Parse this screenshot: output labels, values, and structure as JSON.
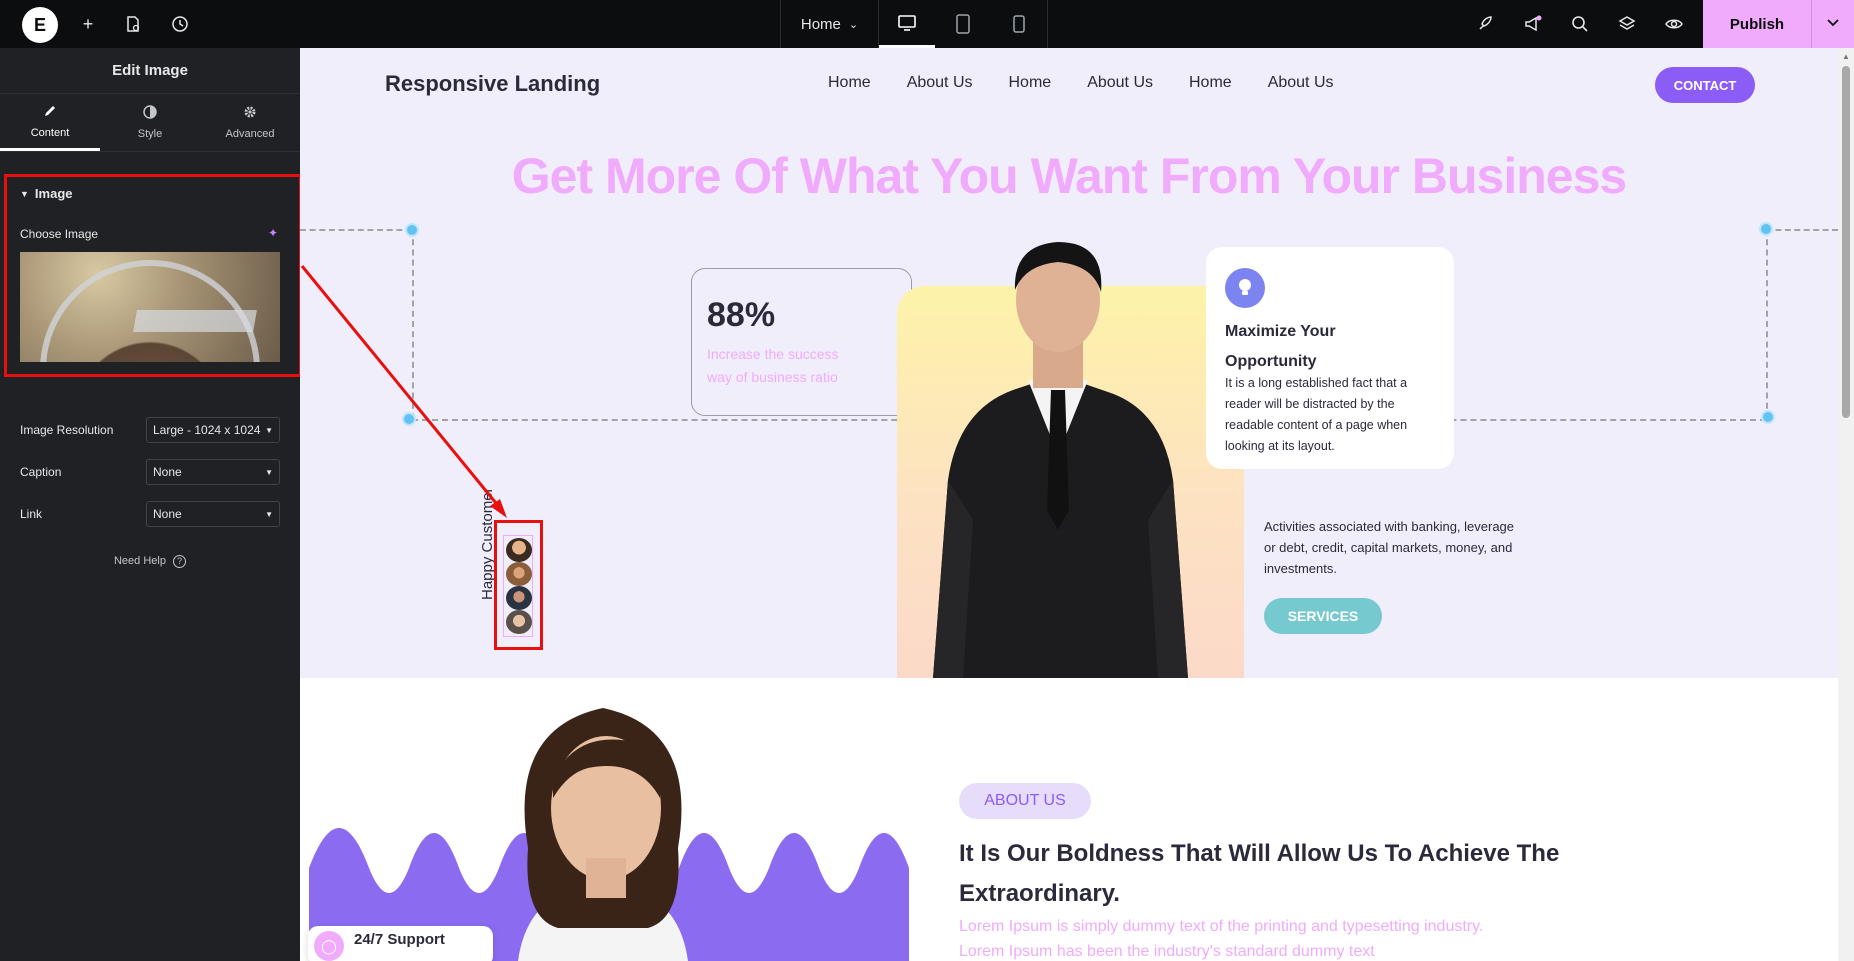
{
  "topbar": {
    "page_name": "Home",
    "publish_label": "Publish",
    "icons": [
      "elementor-logo-icon",
      "add-icon",
      "page-settings-icon",
      "history-icon",
      "desktop-icon",
      "tablet-icon",
      "mobile-icon",
      "rocket-icon",
      "announcements-icon",
      "search-icon",
      "layers-icon",
      "preview-icon",
      "chevron-down-icon"
    ]
  },
  "panel": {
    "title": "Edit Image",
    "tabs": [
      {
        "label": "Content",
        "icon": "pencil-icon"
      },
      {
        "label": "Style",
        "icon": "half-circle-icon"
      },
      {
        "label": "Advanced",
        "icon": "gear-icon"
      }
    ],
    "section_title": "Image",
    "choose_image_label": "Choose Image",
    "fields": [
      {
        "label": "Image Resolution",
        "value": "Large - 1024 x 1024"
      },
      {
        "label": "Caption",
        "value": "None"
      },
      {
        "label": "Link",
        "value": "None"
      }
    ],
    "need_help": "Need Help"
  },
  "site": {
    "brand": "Responsive Landing",
    "nav": [
      "Home",
      "About Us",
      "Home",
      "About Us",
      "Home",
      "About Us"
    ],
    "contact": "CONTACT",
    "headline": "Get More Of What You Want From Your Business",
    "stat": {
      "value": "88%",
      "text": "Increase the success way of business ratio"
    },
    "info_card": {
      "title": "Maximize Your Opportunity",
      "body": "It is a long established fact that a reader will be distracted by the readable content of a page when looking at its layout."
    },
    "activities": "Activities associated with banking, leverage or debt, credit, capital markets, money, and investments.",
    "services": "SERVICES",
    "happy_customer": "Happy Customer",
    "support": "24/7 Support",
    "about": {
      "pill": "ABOUT US",
      "title": "It Is Our Boldness That Will Allow Us To Achieve The Extraordinary.",
      "text": "Lorem Ipsum is simply dummy text of the printing and typesetting industry. Lorem Ipsum has been the industry's standard dummy text"
    }
  },
  "colors": {
    "accent_pink": "#f0abfc",
    "purple": "#8b5cf6",
    "teal": "#76c9cf",
    "annotation_red": "#e8100f",
    "hero_bg": "#f1eefc"
  }
}
